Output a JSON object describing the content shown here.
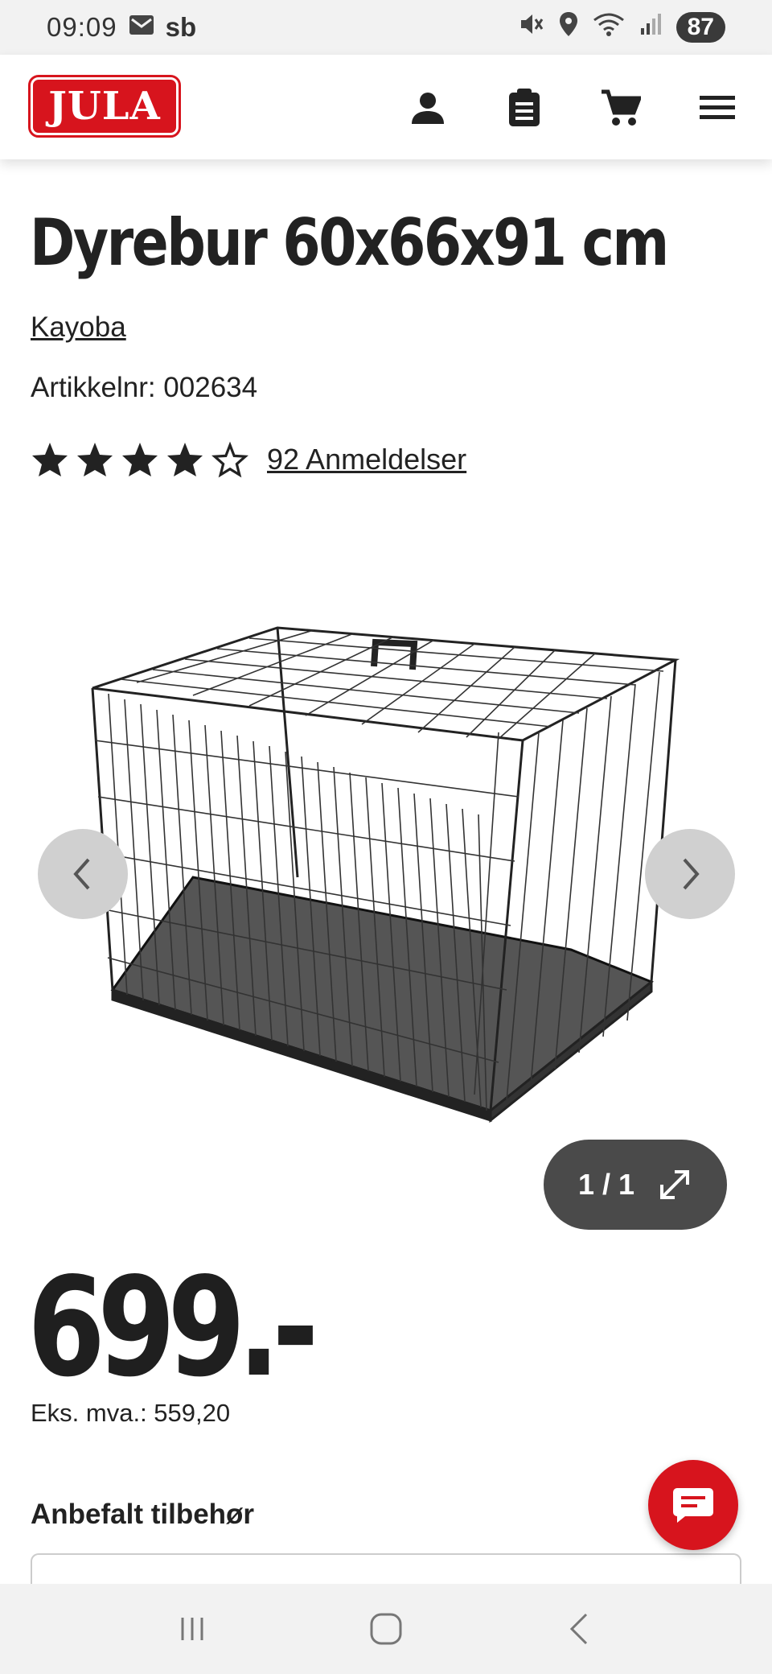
{
  "status_bar": {
    "time": "09:09",
    "carrier": "sb",
    "battery": "87"
  },
  "header": {
    "logo_text": "JULA",
    "icons": [
      "account-icon",
      "clipboard-icon",
      "cart-icon",
      "menu-icon"
    ]
  },
  "product": {
    "title": "Dyrebur 60x66x91 cm",
    "brand": "Kayoba",
    "article_number": "Artikkelnr: 002634",
    "rating": 4,
    "rating_max": 5,
    "reviews": "92 Anmeldelser",
    "image_counter": "1 / 1",
    "price": "699.-",
    "price_ex_vat": "Eks. mva.: 559,20"
  },
  "sections": {
    "accessories_heading": "Anbefalt tilbehør"
  },
  "colors": {
    "brand_red": "#d7141d",
    "counter_bg": "#4a4a4a"
  }
}
